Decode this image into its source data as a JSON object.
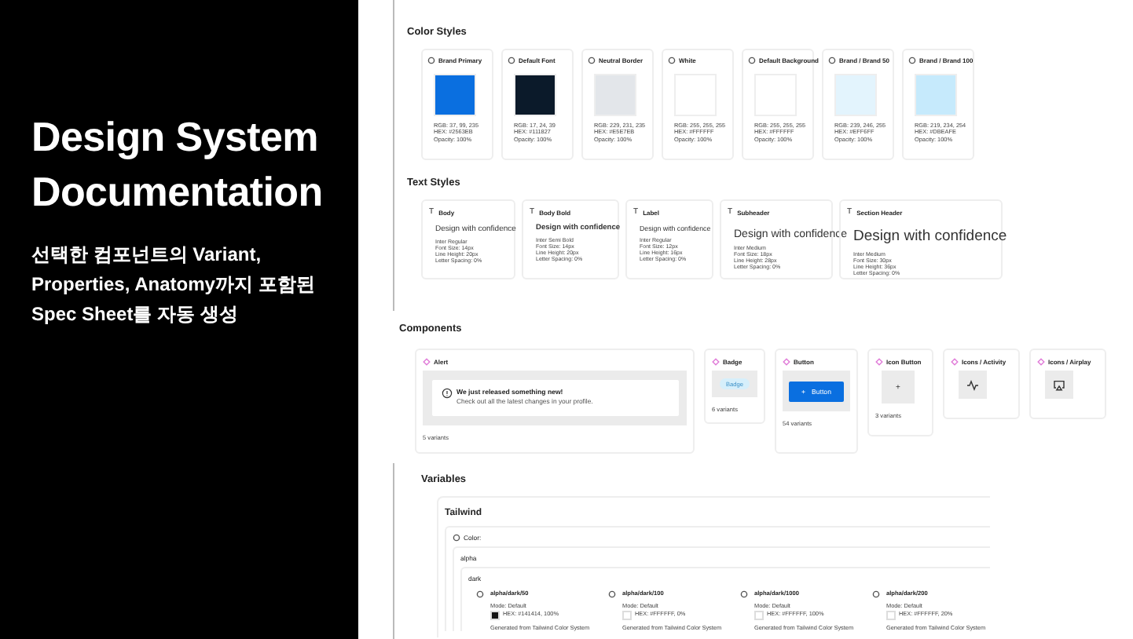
{
  "intro": {
    "title": "Design System Documentation",
    "subtitle": "선택한 컴포넌트의 Variant, Properties, Anatomy까지 포함된 Spec Sheet를 자동 생성"
  },
  "color_styles": {
    "heading": "Color Styles",
    "items": [
      {
        "name": "Brand Primary",
        "color": "#0a6fe0",
        "rgb": "RGB: 37, 99, 235",
        "hex": "HEX: #2563EB",
        "opacity": "Opacity: 100%"
      },
      {
        "name": "Default Font",
        "color": "#0b1a2a",
        "rgb": "RGB: 17, 24, 39",
        "hex": "HEX: #111827",
        "opacity": "Opacity: 100%"
      },
      {
        "name": "Neutral Border",
        "color": "#e3e6ea",
        "rgb": "RGB: 229, 231, 235",
        "hex": "HEX: #E5E7EB",
        "opacity": "Opacity: 100%"
      },
      {
        "name": "White",
        "color": "#ffffff",
        "rgb": "RGB: 255, 255, 255",
        "hex": "HEX: #FFFFFF",
        "opacity": "Opacity: 100%"
      },
      {
        "name": "Default Background",
        "color": "#ffffff",
        "rgb": "RGB: 255, 255, 255",
        "hex": "HEX: #FFFFFF",
        "opacity": "Opacity: 100%"
      },
      {
        "name": "Brand / Brand 50",
        "color": "#e3f4fd",
        "rgb": "RGB: 239, 246, 255",
        "hex": "HEX: #EFF6FF",
        "opacity": "Opacity: 100%"
      },
      {
        "name": "Brand / Brand 100",
        "color": "#c6eafc",
        "rgb": "RGB: 219, 234, 254",
        "hex": "HEX: #DBEAFE",
        "opacity": "Opacity: 100%"
      }
    ]
  },
  "text_styles": {
    "heading": "Text Styles",
    "items": [
      {
        "kind": "body",
        "icon": "T",
        "name": "Body",
        "sample": "Design with confidence",
        "specs": [
          "Inter Regular",
          "Font Size: 14px",
          "Line Height: 20px",
          "Letter Spacing: 0%"
        ]
      },
      {
        "kind": "body-bold",
        "icon": "T",
        "name": "Body Bold",
        "sample": "Design with confidence",
        "specs": [
          "Inter Semi Bold",
          "Font Size: 14px",
          "Line Height: 20px",
          "Letter Spacing: 0%"
        ]
      },
      {
        "kind": "label",
        "icon": "T",
        "name": "Label",
        "sample": "Design with confidence",
        "specs": [
          "Inter Regular",
          "Font Size: 12px",
          "Line Height: 16px",
          "Letter Spacing: 0%"
        ]
      },
      {
        "kind": "subheader",
        "icon": "T",
        "name": "Subheader",
        "sample": "Design with confidence",
        "specs": [
          "Inter Medium",
          "Font Size: 18px",
          "Line Height: 28px",
          "Letter Spacing: 0%"
        ]
      },
      {
        "kind": "section-header",
        "icon": "T",
        "name": "Section Header",
        "sample": "Design with confidence",
        "specs": [
          "Inter Medium",
          "Font Size: 30px",
          "Line Height: 36px",
          "Letter Spacing: 0%"
        ]
      }
    ]
  },
  "components": {
    "heading": "Components",
    "items": [
      {
        "kind": "alert",
        "name": "Alert",
        "title": "We just released something new!",
        "message": "Check out all the latest changes in your profile.",
        "variants": "5 variants"
      },
      {
        "kind": "badge",
        "name": "Badge",
        "label": "Badge",
        "variants": "6 variants"
      },
      {
        "kind": "button",
        "name": "Button",
        "glyph": "+",
        "label": "Button",
        "variants": "54 variants"
      },
      {
        "kind": "icon-button",
        "name": "Icon Button",
        "glyph": "+",
        "variants": "3 variants"
      },
      {
        "kind": "icon-activity",
        "name": "Icons / Activity"
      },
      {
        "kind": "icon-airplay",
        "name": "Icons / Airplay"
      }
    ]
  },
  "variables": {
    "heading": "Variables",
    "collection": "Tailwind",
    "group": "Color:",
    "subgroup": "alpha",
    "set": "dark",
    "items": [
      {
        "name": "alpha/dark/50",
        "mode": "Mode: Default",
        "color": "#141414",
        "hex": "HEX: #141414, 100%",
        "note": "Generated from Tailwind Color System"
      },
      {
        "name": "alpha/dark/100",
        "mode": "Mode: Default",
        "color": "#ffffff",
        "hex": "HEX: #FFFFFF, 0%",
        "note": "Generated from Tailwind Color System"
      },
      {
        "name": "alpha/dark/1000",
        "mode": "Mode: Default",
        "color": "#ffffff",
        "hex": "HEX: #FFFFFF, 100%",
        "note": "Generated from Tailwind Color System"
      },
      {
        "name": "alpha/dark/200",
        "mode": "Mode: Default",
        "color": "#ffffff",
        "hex": "HEX: #FFFFFF, 20%",
        "note": "Generated from Tailwind Color System"
      }
    ]
  }
}
